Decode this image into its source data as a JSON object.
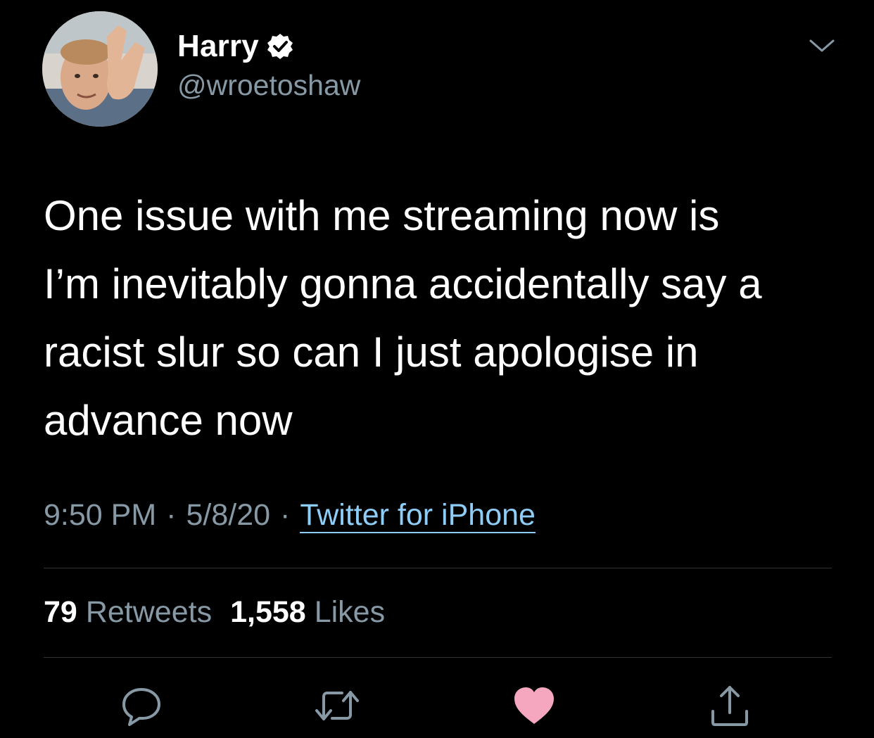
{
  "user": {
    "display_name": "Harry",
    "handle": "@wroetoshaw",
    "verified": true
  },
  "tweet": {
    "text": "One issue with me streaming now is\nI’m inevitably gonna accidentally say a\nracist slur so can I just apologise in\nadvance now",
    "time": "9:50 PM",
    "date": "5/8/20",
    "separator": "·",
    "source": "Twitter for iPhone"
  },
  "stats": {
    "retweets_count": "79",
    "retweets_label": "Retweets",
    "likes_count": "1,558",
    "likes_label": "Likes"
  },
  "icons": {
    "verified": "verified-badge-icon",
    "menu": "chevron-down-icon",
    "reply": "reply-icon",
    "retweet": "retweet-icon",
    "like": "heart-icon",
    "share": "share-icon"
  },
  "colors": {
    "background": "#000000",
    "text": "#ffffff",
    "secondary": "#8899a6",
    "link": "#8ecdf8",
    "like_active": "#f4a7be"
  }
}
